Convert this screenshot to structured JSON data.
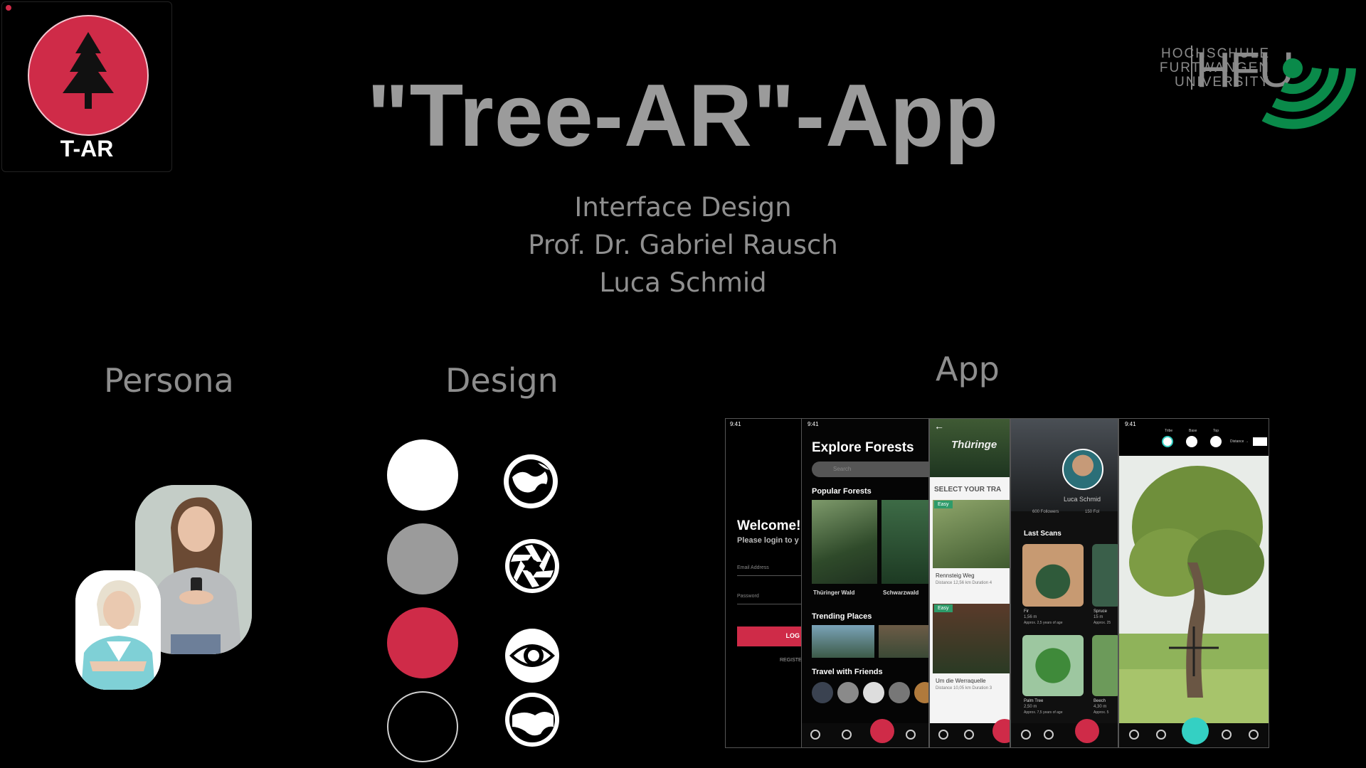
{
  "header": {
    "title": "\"Tree-AR\"-App",
    "subtitle_lines": [
      "Interface Design",
      "Prof. Dr. Gabriel Rausch",
      "Luca Schmid"
    ],
    "app_logo_text": "T-AR",
    "university": {
      "line1": "HOCHSCHULE",
      "line2": "FURTWANGEN",
      "line3": "UNIVERSITY",
      "short": "HFU"
    }
  },
  "sections": {
    "persona": "Persona",
    "design": "Design",
    "app": "App"
  },
  "design": {
    "colors": [
      "#ffffff",
      "#9b9b9b",
      "#cf2b48",
      "#000000"
    ],
    "icons": [
      "globe-icon",
      "aperture-icon",
      "eye-icon",
      "profile-icon"
    ]
  },
  "screens": {
    "login": {
      "time": "9:41",
      "welcome": "Welcome!",
      "prompt": "Please login to y",
      "email_label": "Email Address",
      "password_label": "Password",
      "login_button": "LOG",
      "register": "REGISTE"
    },
    "explore": {
      "time": "9:41",
      "title": "Explore Forests",
      "search_placeholder": "Search",
      "popular": "Popular Forests",
      "forest1": "Thüringer Wald",
      "forest2": "Schwarzwald",
      "trending": "Trending Places",
      "travel": "Travel with Friends"
    },
    "trails": {
      "header_word": "Thüringe",
      "select": "SELECT YOUR TRA",
      "badge1": "Easy",
      "trail1": "Rennsteig Weg",
      "trail1_meta": "Distance 12,56 km   Duration 4",
      "badge2": "Easy",
      "trail2": "Um die Werraquelle",
      "trail2_meta": "Distance 10,05 km   Duration 3"
    },
    "profile": {
      "name": "Luca Schmid",
      "followers": "600 Followers",
      "following": "150 Fol",
      "last_scans": "Last Scans",
      "scan1_name": "Fir",
      "scan1_size": "1,56 m",
      "scan1_age": "Approx. 2,5 years of age",
      "scan2_name": "Spruce",
      "scan2_size": "15 m",
      "scan2_age": "Approx. 25",
      "scan3_name": "Palm Tree",
      "scan3_size": "2,50 m",
      "scan3_age": "Approx. 7,5 years of age",
      "scan4_name": "Beech",
      "scan4_size": "4,30 m",
      "scan4_age": "Approx. 5"
    },
    "ar": {
      "time": "9:41",
      "opt1": "Tribe",
      "opt2": "Base",
      "opt3": "Top",
      "distance_label": "Distance →"
    }
  }
}
